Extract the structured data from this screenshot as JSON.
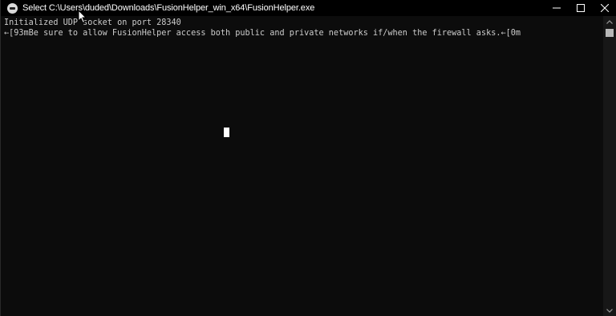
{
  "window": {
    "title": "Select C:\\Users\\duded\\Downloads\\FusionHelper_win_x64\\FusionHelper.exe",
    "app_icon": "console-app-icon",
    "controls": {
      "minimize": "minimize-icon",
      "maximize": "maximize-icon",
      "close": "close-icon"
    }
  },
  "console": {
    "lines": [
      "Initialized UDP socket on port 28340",
      "←[93mBe sure to allow FusionHelper access both public and private networks if/when the firewall asks.←[0m"
    ],
    "background": "#0c0c0c",
    "text_color": "#cccccc"
  },
  "scrollbar": {
    "up_icon": "scroll-up-arrow-icon",
    "down_icon": "scroll-down-arrow-icon"
  },
  "pointer": "mouse-pointer-icon"
}
